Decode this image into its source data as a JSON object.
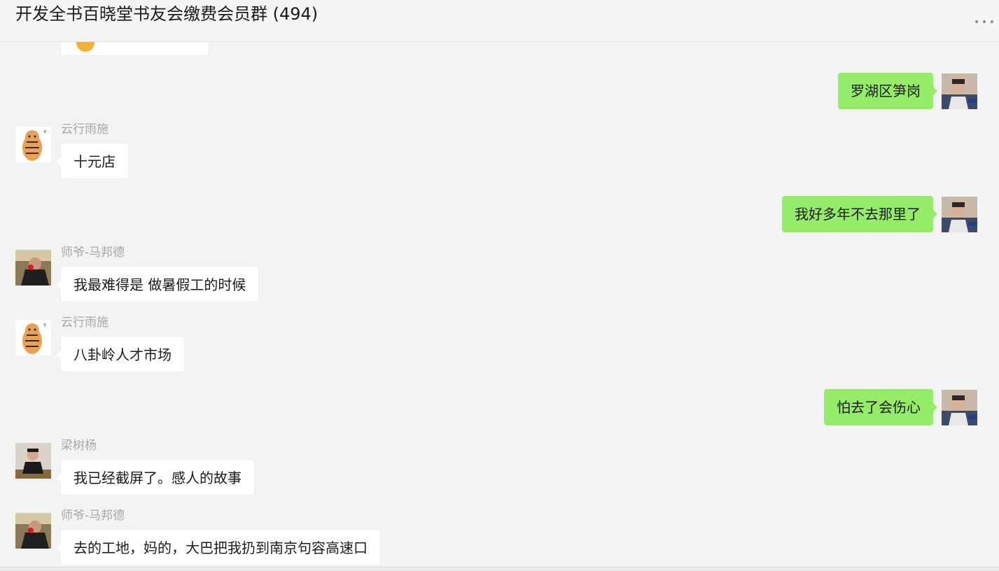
{
  "window": {
    "title": "开发全书百晓堂书友会缴费会员群 (494)",
    "more_icon": "more-dots-icon"
  },
  "colors": {
    "outgoing_bubble": "#95ec69",
    "incoming_bubble": "#ffffff",
    "background": "#f3f3f3",
    "sender_name": "#a8a8a8"
  },
  "messages": [
    {
      "direction": "in",
      "sender": "",
      "text": "",
      "avatar": "emoji-icon",
      "partial": true
    },
    {
      "direction": "out",
      "text": "罗湖区笋岗",
      "avatar": "self-avatar"
    },
    {
      "direction": "in",
      "sender": "云行雨施",
      "text": "十元店",
      "avatar": "tiger-avatar"
    },
    {
      "direction": "out",
      "text": "我好多年不去那里了",
      "avatar": "self-avatar"
    },
    {
      "direction": "in",
      "sender": "师爷-马邦德",
      "text": "我最难得是  做暑假工的时候",
      "avatar": "rose-avatar"
    },
    {
      "direction": "in",
      "sender": "云行雨施",
      "text": "八卦岭人才市场",
      "avatar": "tiger-avatar"
    },
    {
      "direction": "out",
      "text": "怕去了会伤心",
      "avatar": "self-avatar"
    },
    {
      "direction": "in",
      "sender": "梁树杨",
      "text": "我已经截屏了。感人的故事",
      "avatar": "person-avatar"
    },
    {
      "direction": "in",
      "sender": "师爷-马邦德",
      "text": "去的工地，妈的，大巴把我扔到南京句容高速口",
      "avatar": "rose-avatar"
    }
  ]
}
